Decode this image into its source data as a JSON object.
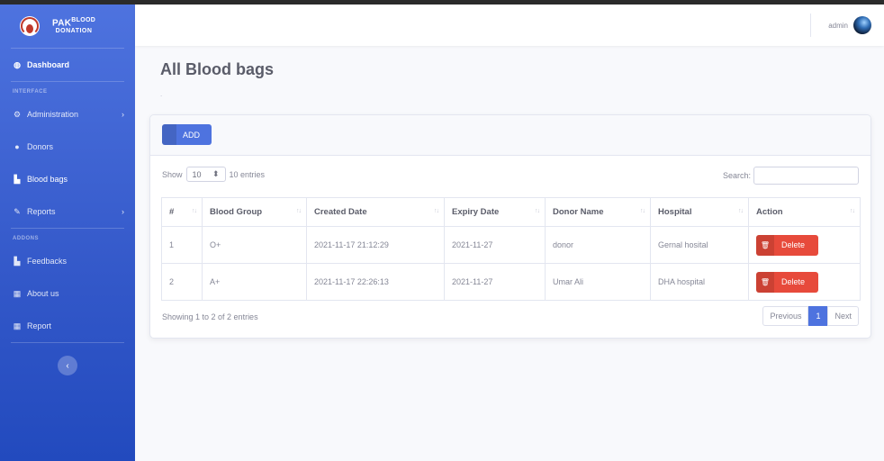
{
  "brand": {
    "line1": "PAK",
    "line1_sup": "BLOOD",
    "line2": "DONATION"
  },
  "sidebar": {
    "dashboard": "Dashboard",
    "heading_interface": "INTERFACE",
    "administration": "Administration",
    "donors": "Donors",
    "blood_bags": "Blood bags",
    "reports": "Reports",
    "heading_addons": "ADDONS",
    "feedbacks": "Feedbacks",
    "about": "About us",
    "report": "Report",
    "toggle": "‹"
  },
  "topbar": {
    "username": "admin"
  },
  "page": {
    "title": "All Blood bags",
    "dot": "."
  },
  "card": {
    "add_label": "ADD",
    "show_label": "Show",
    "length_value": "10",
    "entries_label": "10 entries",
    "search_label": "Search:",
    "columns": [
      "#",
      "Blood Group",
      "Created Date",
      "Expiry Date",
      "Donor Name",
      "Hospital",
      "Action"
    ],
    "rows": [
      {
        "num": "1",
        "group": "O+",
        "created": "2021-11-17 21:12:29",
        "expiry": "2021-11-27",
        "donor": "donor",
        "hospital": "Gernal hosital",
        "action": "Delete"
      },
      {
        "num": "2",
        "group": "A+",
        "created": "2021-11-17 22:26:13",
        "expiry": "2021-11-27",
        "donor": "Umar Ali",
        "hospital": "DHA hospital",
        "action": "Delete"
      }
    ],
    "info": "Showing 1 to 2 of 2 entries",
    "pager": {
      "prev": "Previous",
      "current": "1",
      "next": "Next"
    }
  },
  "colors": {
    "primary": "#4e73df",
    "danger": "#e74a3b",
    "sidebar_end": "#224abe"
  }
}
